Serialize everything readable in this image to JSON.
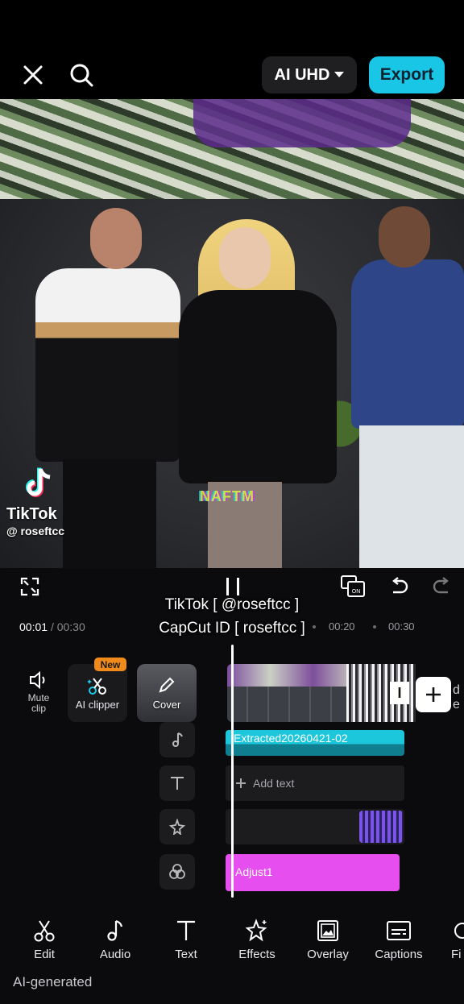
{
  "topbar": {
    "quality_label": "AI UHD",
    "export_label": "Export"
  },
  "preview": {
    "watermark_brand": "TikTok",
    "watermark_handle": "@ roseftcc",
    "glitch_text": "NAFTM"
  },
  "player": {
    "overlay_line1": "TikTok [ @roseftcc ]",
    "overlay_line2": "CapCut ID [ roseftcc ]",
    "current_time": "00:01",
    "total_time": "/ 00:30",
    "ruler_marks": [
      "00:20",
      "00:30"
    ]
  },
  "timeline": {
    "mute_label": "Mute clip",
    "ai_clipper_label": "AI clipper",
    "new_badge": "New",
    "cover_label": "Cover",
    "audio_clip_label": "Extracted20260421-02",
    "add_text_label": "Add text",
    "adjust_clip_label": "Adjust1",
    "peek_text": "d e"
  },
  "toolbar": {
    "items": [
      {
        "label": "Edit",
        "icon": "scissors-icon"
      },
      {
        "label": "Audio",
        "icon": "music-note-icon"
      },
      {
        "label": "Text",
        "icon": "text-icon"
      },
      {
        "label": "Effects",
        "icon": "sparkle-star-icon"
      },
      {
        "label": "Overlay",
        "icon": "overlay-image-icon"
      },
      {
        "label": "Captions",
        "icon": "captions-icon"
      },
      {
        "label": "Fi",
        "icon": "filters-icon"
      }
    ]
  },
  "footer": {
    "ai_generated": "AI-generated"
  },
  "colors": {
    "export_button": "#19c6e6",
    "audio_clip": "#1cc7dc",
    "adjust_clip": "#e64ef0",
    "new_badge": "#f08a1a"
  }
}
